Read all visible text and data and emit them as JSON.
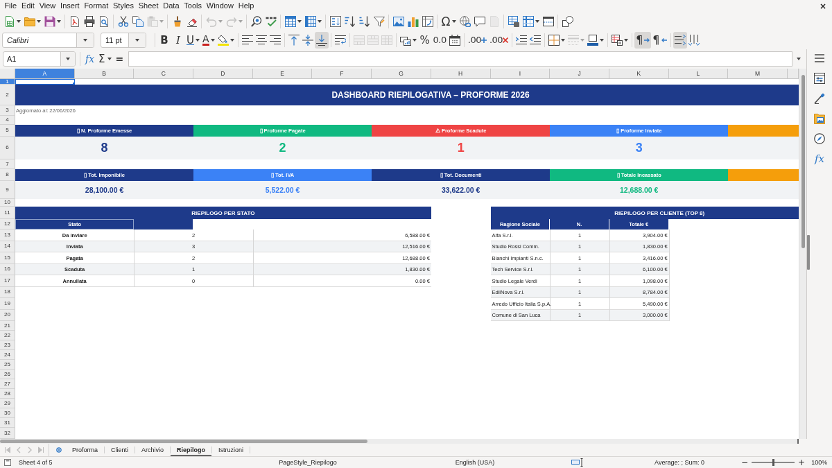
{
  "menu_bar": {
    "items": [
      "File",
      "Edit",
      "View",
      "Insert",
      "Format",
      "Styles",
      "Sheet",
      "Data",
      "Tools",
      "Window",
      "Help"
    ],
    "close_button": "×"
  },
  "standard_toolbar": {
    "groups": [
      [
        {
          "kind": "new",
          "dropdown": true,
          "disabled": false,
          "selected": false
        },
        {
          "kind": "open",
          "dropdown": true,
          "disabled": false,
          "selected": false
        },
        {
          "kind": "save",
          "dropdown": true,
          "disabled": false,
          "selected": false
        }
      ],
      [
        {
          "kind": "export_pdf",
          "disabled": false,
          "selected": false
        },
        {
          "kind": "print",
          "disabled": false,
          "selected": false
        },
        {
          "kind": "print_preview",
          "disabled": false,
          "selected": false
        }
      ],
      [
        {
          "kind": "cut",
          "disabled": false,
          "selected": false
        },
        {
          "kind": "copy",
          "disabled": false,
          "selected": false
        },
        {
          "kind": "paste",
          "dropdown": true,
          "disabled": true,
          "selected": false
        }
      ],
      [
        {
          "kind": "clone_formatting",
          "disabled": false,
          "selected": false
        },
        {
          "kind": "clear_formatting",
          "disabled": false,
          "selected": false
        }
      ],
      [
        {
          "kind": "undo",
          "dropdown": true,
          "disabled": true,
          "selected": false
        },
        {
          "kind": "redo",
          "dropdown": true,
          "disabled": true,
          "selected": false
        }
      ],
      [
        {
          "kind": "find_replace",
          "disabled": false,
          "selected": false
        },
        {
          "kind": "spelling",
          "disabled": false,
          "selected": false
        }
      ],
      [
        {
          "kind": "rows",
          "dropdown": true,
          "disabled": false,
          "selected": false
        },
        {
          "kind": "columns",
          "dropdown": true,
          "disabled": false,
          "selected": false
        }
      ],
      [
        {
          "kind": "sort",
          "disabled": false,
          "selected": false
        },
        {
          "kind": "sort_ascending",
          "disabled": false,
          "selected": false
        },
        {
          "kind": "sort_descending",
          "disabled": false,
          "selected": false
        },
        {
          "kind": "autofilter",
          "disabled": false,
          "selected": false
        }
      ],
      [
        {
          "kind": "image",
          "disabled": false,
          "selected": false
        },
        {
          "kind": "chart",
          "disabled": false,
          "selected": false
        },
        {
          "kind": "pivot_table",
          "disabled": false,
          "selected": false
        }
      ],
      [
        {
          "kind": "special_character",
          "label": "Ω",
          "dropdown": true,
          "disabled": false,
          "selected": false
        },
        {
          "kind": "hyperlink",
          "disabled": false,
          "selected": false
        },
        {
          "kind": "comment",
          "disabled": false,
          "selected": false
        },
        {
          "kind": "header_footer",
          "disabled": true,
          "selected": false
        }
      ],
      [
        {
          "kind": "print_area",
          "disabled": false,
          "selected": false
        },
        {
          "kind": "freeze",
          "dropdown": true,
          "disabled": false,
          "selected": false
        },
        {
          "kind": "split_window",
          "disabled": false,
          "selected": false
        }
      ],
      [
        {
          "kind": "draw_functions",
          "disabled": false,
          "selected": false
        }
      ]
    ]
  },
  "formatting_toolbar": {
    "font_name": "Calibri",
    "font_size": "11 pt",
    "groups": [
      [
        {
          "kind": "bold",
          "label": "B",
          "disabled": false,
          "selected": false
        },
        {
          "kind": "italic",
          "label": "I",
          "disabled": false,
          "selected": false
        },
        {
          "kind": "underline",
          "label": "U",
          "dropdown": true,
          "disabled": false,
          "selected": false
        },
        {
          "kind": "font_color",
          "label": "A",
          "dropdown": true,
          "disabled": false,
          "selected": false
        },
        {
          "kind": "highlight",
          "dropdown": true,
          "disabled": false,
          "selected": false
        }
      ],
      [
        {
          "kind": "align_left",
          "disabled": false,
          "selected": false
        },
        {
          "kind": "align_center",
          "disabled": false,
          "selected": false
        },
        {
          "kind": "align_right",
          "disabled": false,
          "selected": false
        }
      ],
      [
        {
          "kind": "align_top",
          "disabled": false,
          "selected": false
        },
        {
          "kind": "align_middle",
          "disabled": false,
          "selected": false
        },
        {
          "kind": "align_bottom",
          "disabled": false,
          "selected": true
        }
      ],
      [
        {
          "kind": "wrap_text",
          "disabled": false,
          "selected": false
        }
      ],
      [
        {
          "kind": "merge_center",
          "disabled": true,
          "selected": false
        },
        {
          "kind": "merge_cells",
          "disabled": true,
          "selected": false
        },
        {
          "kind": "unmerge_cells",
          "disabled": true,
          "selected": false
        }
      ],
      [
        {
          "kind": "currency",
          "dropdown": true,
          "disabled": false,
          "selected": false
        },
        {
          "kind": "percent",
          "label": "%",
          "disabled": false,
          "selected": false
        },
        {
          "kind": "number_format",
          "label": "0.0",
          "disabled": false,
          "selected": false
        },
        {
          "kind": "date",
          "disabled": false,
          "selected": false
        }
      ],
      [
        {
          "kind": "add_decimal",
          "label": ".00",
          "disabled": false,
          "selected": false
        },
        {
          "kind": "delete_decimal",
          "label": ".00",
          "disabled": false,
          "selected": false
        }
      ],
      [
        {
          "kind": "increase_indent",
          "disabled": false,
          "selected": false
        },
        {
          "kind": "decrease_indent",
          "disabled": false,
          "selected": false
        }
      ],
      [
        {
          "kind": "borders",
          "dropdown": true,
          "disabled": false,
          "selected": false
        },
        {
          "kind": "border_style",
          "dropdown": true,
          "disabled": true,
          "selected": false
        },
        {
          "kind": "border_color",
          "dropdown": true,
          "disabled": false,
          "selected": false
        }
      ],
      [
        {
          "kind": "conditional",
          "dropdown": true,
          "disabled": false,
          "selected": false
        }
      ],
      [
        {
          "kind": "left_to_right",
          "label": "¶",
          "disabled": false,
          "selected": true
        },
        {
          "kind": "right_to_left",
          "label": "¶",
          "disabled": false,
          "selected": false
        }
      ],
      [
        {
          "kind": "text_horizontal",
          "disabled": false,
          "selected": true
        },
        {
          "kind": "text_vertical",
          "disabled": false,
          "selected": false
        }
      ]
    ]
  },
  "formula_bar": {
    "name_box": "A1",
    "function_wizard": "fx",
    "sum": "Σ",
    "formula": "="
  },
  "sidebar": [
    {
      "kind": "menu"
    },
    {
      "kind": "properties"
    },
    {
      "kind": "styles"
    },
    {
      "kind": "gallery"
    },
    {
      "kind": "navigator"
    },
    {
      "kind": "functions",
      "label": "fx"
    }
  ],
  "columns": [
    {
      "label": "A",
      "selected": true
    },
    {
      "label": "B",
      "selected": false
    },
    {
      "label": "C",
      "selected": false
    },
    {
      "label": "D",
      "selected": false
    },
    {
      "label": "E",
      "selected": false
    },
    {
      "label": "F",
      "selected": false
    },
    {
      "label": "G",
      "selected": false
    },
    {
      "label": "H",
      "selected": false
    },
    {
      "label": "I",
      "selected": false
    },
    {
      "label": "J",
      "selected": false
    },
    {
      "label": "K",
      "selected": false
    },
    {
      "label": "L",
      "selected": false
    },
    {
      "label": "M",
      "selected": false
    }
  ],
  "rows": [
    {
      "label": "1",
      "selected": true
    },
    {
      "label": "2",
      "selected": false
    },
    {
      "label": "3",
      "selected": false
    },
    {
      "label": "4",
      "selected": false
    },
    {
      "label": "5",
      "selected": false
    },
    {
      "label": "6",
      "selected": false
    },
    {
      "label": "7",
      "selected": false
    },
    {
      "label": "8",
      "selected": false
    },
    {
      "label": "9",
      "selected": false
    },
    {
      "label": "10",
      "selected": false
    },
    {
      "label": "11",
      "selected": false
    },
    {
      "label": "12",
      "selected": false
    },
    {
      "label": "13",
      "selected": false
    },
    {
      "label": "14",
      "selected": false
    },
    {
      "label": "15",
      "selected": false
    },
    {
      "label": "16",
      "selected": false
    },
    {
      "label": "17",
      "selected": false
    },
    {
      "label": "18",
      "selected": false
    },
    {
      "label": "19",
      "selected": false
    },
    {
      "label": "20",
      "selected": false
    },
    {
      "label": "21",
      "selected": false
    },
    {
      "label": "22",
      "selected": false
    },
    {
      "label": "23",
      "selected": false
    },
    {
      "label": "24",
      "selected": false
    },
    {
      "label": "25",
      "selected": false
    },
    {
      "label": "26",
      "selected": false
    },
    {
      "label": "27",
      "selected": false
    },
    {
      "label": "28",
      "selected": false
    },
    {
      "label": "29",
      "selected": false
    },
    {
      "label": "30",
      "selected": false
    },
    {
      "label": "31",
      "selected": false
    },
    {
      "label": "32",
      "selected": false
    }
  ],
  "title": "DASHBOARD RIEPILOGATIVA – PROFORME 2026",
  "updated": "Aggiornato al: 22/06/2026",
  "kpi_counts": [
    {
      "label": "▯ N. Proforme Emesse",
      "value": "8",
      "color": "#1e3a8a"
    },
    {
      "label": "▯ Proforme Pagate",
      "value": "2",
      "color": "#10b981"
    },
    {
      "label": "⚠ Proforme Scadute",
      "value": "1",
      "color": "#ef4444"
    },
    {
      "label": "▯ Proforme Inviate",
      "value": "3",
      "color": "#3b82f6"
    },
    {
      "color": "#f59e0b"
    }
  ],
  "kpi_totals": [
    {
      "label": "▯ Tot. Imponibile",
      "value": "28,100.00 €",
      "color": "#1e3a8a"
    },
    {
      "label": "▯ Tot. IVA",
      "value": "5,522.00 €",
      "color": "#3b82f6"
    },
    {
      "label": "▯ Tot. Documenti",
      "value": "33,622.00 €",
      "color": "#1e3a8a"
    },
    {
      "label": "▯ Totale Incassato",
      "value": "12,688.00 €",
      "color": "#10b981"
    },
    {
      "color": "#f59e0b"
    }
  ],
  "status_summary": {
    "title": "RIEPILOGO PER STATO",
    "header": "Stato",
    "rows": [
      {
        "status": "Da inviare",
        "count": "2",
        "total": "6,588.00 €"
      },
      {
        "status": "Inviata",
        "count": "3",
        "total": "12,516.00 €"
      },
      {
        "status": "Pagata",
        "count": "2",
        "total": "12,688.00 €"
      },
      {
        "status": "Scaduta",
        "count": "1",
        "total": "1,830.00 €"
      },
      {
        "status": "Annullata",
        "count": "0",
        "total": "0.00 €"
      }
    ]
  },
  "client_summary": {
    "title": "RIEPILOGO PER CLIENTE (TOP 8)",
    "columns": [
      "Ragione Sociale",
      "N.",
      "Totale €"
    ],
    "rows": [
      {
        "client": "Alfa S.r.l.",
        "count": "1",
        "total": "3,904.00 €"
      },
      {
        "client": "Studio Rossi Comm.",
        "count": "1",
        "total": "1,830.00 €"
      },
      {
        "client": "Bianchi Impianti S.n.c.",
        "count": "1",
        "total": "3,416.00 €"
      },
      {
        "client": "Tech Service S.r.l.",
        "count": "1",
        "total": "6,100.00 €"
      },
      {
        "client": "Studio Legale Verdi",
        "count": "1",
        "total": "1,098.00 €"
      },
      {
        "client": "EdilNova S.r.l.",
        "count": "1",
        "total": "8,784.00 €"
      },
      {
        "client": "Arredo Ufficio Italia S.p.A.",
        "count": "1",
        "total": "5,490.00 €"
      },
      {
        "client": "Comune di San Luca",
        "count": "1",
        "total": "3,000.00 €"
      }
    ]
  },
  "sheet_nav": [
    {
      "kind": "first",
      "disabled": true
    },
    {
      "kind": "previous",
      "disabled": true
    },
    {
      "kind": "next",
      "disabled": true
    },
    {
      "kind": "last",
      "disabled": true
    }
  ],
  "sheet_tabs": [
    {
      "label": "Proforma",
      "selected": false
    },
    {
      "label": "Clienti",
      "selected": false
    },
    {
      "label": "Archivio",
      "selected": false
    },
    {
      "label": "Riepilogo",
      "selected": true
    },
    {
      "label": "Istruzioni",
      "selected": false
    }
  ],
  "status_bar": {
    "sheet": "Sheet 4 of 5",
    "page_style": "PageStyle_Riepilogo",
    "language": "English (USA)",
    "selection_summary": "Average: ; Sum: 0",
    "zoom_out": "−",
    "zoom_slider": {
      "level": 0.5
    },
    "zoom_in": "+",
    "zoom": "100%"
  }
}
